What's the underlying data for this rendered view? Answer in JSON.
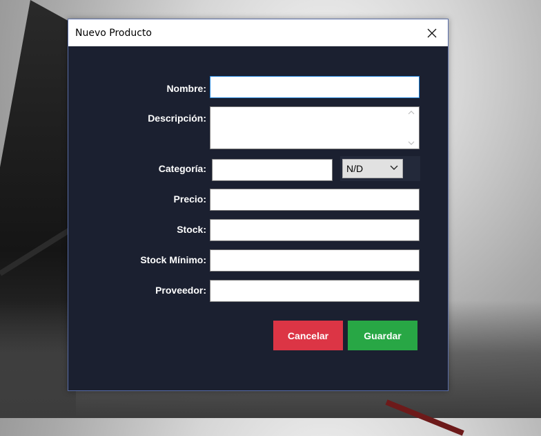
{
  "window": {
    "title": "Nuevo Producto"
  },
  "form": {
    "nombre": {
      "label": "Nombre:",
      "value": ""
    },
    "descripcion": {
      "label": "Descripción:",
      "value": ""
    },
    "categoria": {
      "label": "Categoría:",
      "value": "",
      "selected": "N/D"
    },
    "precio": {
      "label": "Precio:",
      "value": ""
    },
    "stock": {
      "label": "Stock:",
      "value": ""
    },
    "stock_minimo": {
      "label": "Stock Mínimo:",
      "value": ""
    },
    "proveedor": {
      "label": "Proveedor:",
      "value": ""
    }
  },
  "buttons": {
    "cancel": "Cancelar",
    "save": "Guardar"
  },
  "colors": {
    "dialog_bg": "#1b2030",
    "cancel": "#dc3545",
    "save": "#28a745",
    "focus_border": "#1e7fd6"
  },
  "icons": {
    "close": "close-icon",
    "combo_arrow": "chevron-down-icon",
    "scroll_up": "chevron-up-icon",
    "scroll_down": "chevron-down-icon"
  }
}
